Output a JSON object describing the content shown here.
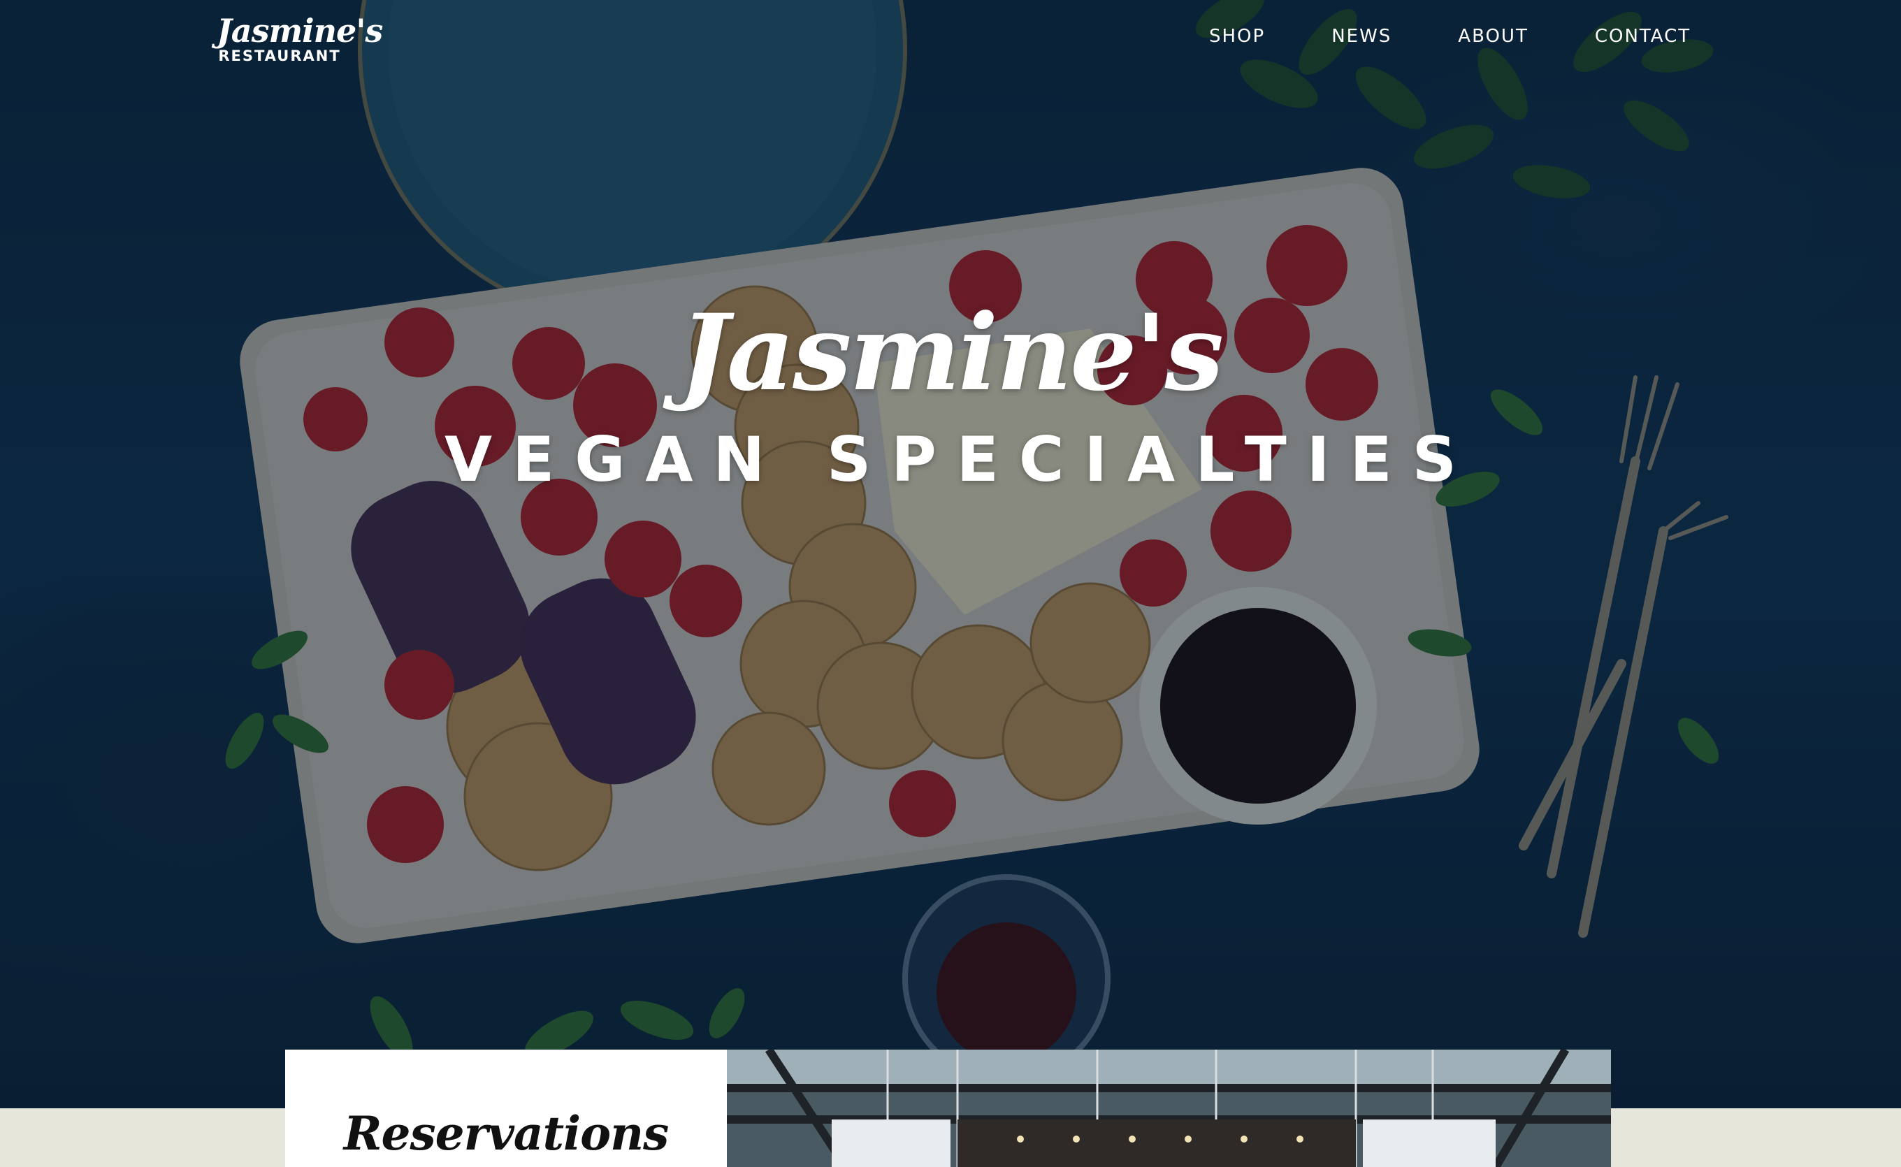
{
  "brand": {
    "logo_script": "Jasmine's",
    "logo_sub": "RESTAURANT"
  },
  "nav": {
    "items": [
      {
        "label": "SHOP"
      },
      {
        "label": "NEWS"
      },
      {
        "label": "ABOUT"
      },
      {
        "label": "CONTACT"
      }
    ]
  },
  "hero": {
    "title": "Jasmine's",
    "subtitle": "VEGAN SPECIALTIES"
  },
  "reservations": {
    "title": "Reservations"
  },
  "colors": {
    "background_dark_blue": "#0e2a44",
    "strip_beige": "#e6e6da",
    "text_white": "#ffffff"
  }
}
